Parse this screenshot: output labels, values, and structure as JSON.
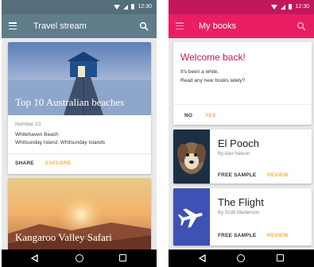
{
  "status_bar": {
    "time": "12:30"
  },
  "left_app": {
    "title": "Travel stream",
    "colors": {
      "appbar": "#607d8b",
      "statusbar": "#546e7a",
      "accent": "#f3b143"
    },
    "card1": {
      "title": "Top 10 Australian beaches",
      "number_label": "Number 10",
      "place": "Whitehaven Beach",
      "location": "Whitsunday Island, Whitsunday Islands",
      "actions": [
        "SHARE",
        "EXPLORE"
      ]
    },
    "card2": {
      "title": "Kangaroo Valley Safari"
    }
  },
  "right_app": {
    "title": "My books",
    "colors": {
      "appbar": "#e91e63",
      "statusbar": "#c2185b",
      "accent": "#f3b143",
      "heading": "#c2185b"
    },
    "welcome": {
      "heading": "Welcome back!",
      "line1": "It's been a while.",
      "line2": "Read any new books lately?",
      "no_label": "NO",
      "yes_label": "YES"
    },
    "books": [
      {
        "title": "El Pooch",
        "author": "By Alex Nelson",
        "sample_label": "FREE SAMPLE",
        "review_label": "REVIEW",
        "cover": "dog-photo"
      },
      {
        "title": "The Flight",
        "author": "By Scott Masterson",
        "sample_label": "FREE SAMPLE",
        "review_label": "REVIEW",
        "cover": "airplane-icon"
      }
    ]
  },
  "nav_icons": [
    "back-icon",
    "home-icon",
    "recent-apps-icon"
  ]
}
